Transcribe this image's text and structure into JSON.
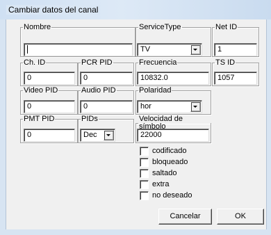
{
  "window": {
    "title": "Cambiar datos del canal"
  },
  "fields": {
    "nombre": {
      "label": "Nombre",
      "value": ""
    },
    "service_type": {
      "label": "ServiceType",
      "value": "TV"
    },
    "net_id": {
      "label": "Net ID",
      "value": "1"
    },
    "ch_id": {
      "label": "Ch. ID",
      "value": "0"
    },
    "pcr_pid": {
      "label": "PCR PID",
      "value": "0"
    },
    "frecuencia": {
      "label": "Frecuencia",
      "value": "10832.0"
    },
    "ts_id": {
      "label": "TS ID",
      "value": "1057"
    },
    "video_pid": {
      "label": "Video PID",
      "value": "0"
    },
    "audio_pid": {
      "label": "Audio PID",
      "value": "0"
    },
    "polaridad": {
      "label": "Polaridad",
      "value": "hor"
    },
    "pmt_pid": {
      "label": "PMT PID",
      "value": "0"
    },
    "pids": {
      "label": "PIDs",
      "value": "Dec"
    },
    "velocidad": {
      "label": "Velocidad de símbolo",
      "value": "22000"
    }
  },
  "checkboxes": [
    {
      "label": "codificado",
      "checked": false
    },
    {
      "label": "bloqueado",
      "checked": false
    },
    {
      "label": "saltado",
      "checked": false
    },
    {
      "label": "extra",
      "checked": false
    },
    {
      "label": "no deseado",
      "checked": false
    }
  ],
  "buttons": {
    "cancel": "Cancelar",
    "ok": "OK"
  }
}
